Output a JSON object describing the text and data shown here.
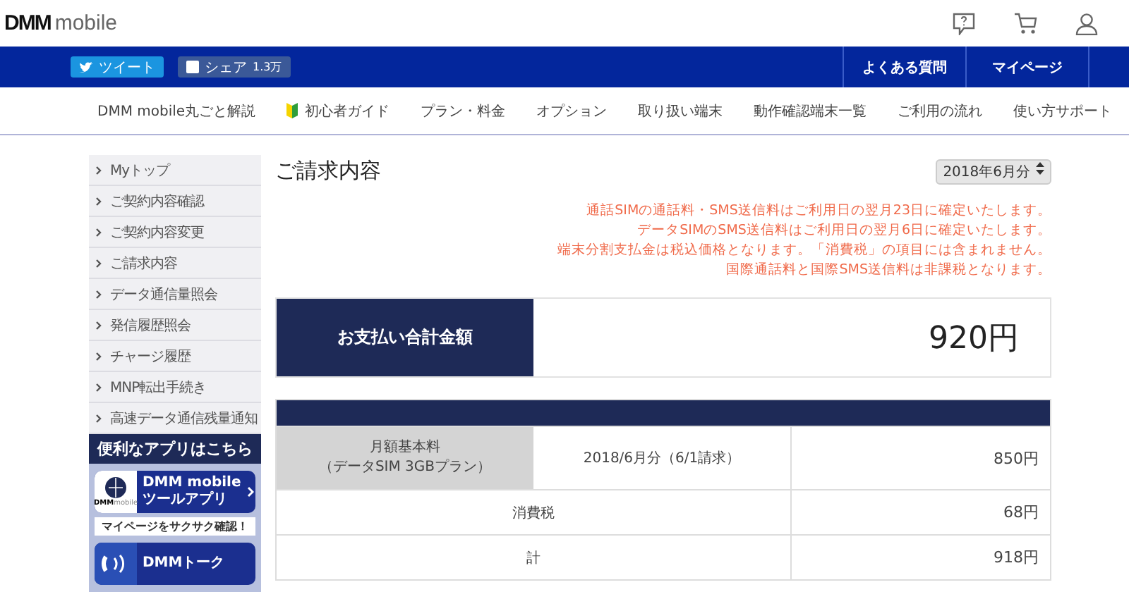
{
  "header": {
    "logo_bold": "DMM",
    "logo_light": "mobile"
  },
  "social": [
    {
      "kind": "twitter",
      "label": "ツイート"
    },
    {
      "kind": "facebook",
      "label": "シェア",
      "count": "1.3万"
    }
  ],
  "top_links": [
    "よくある質問",
    "マイページ"
  ],
  "nav": [
    {
      "label": "DMM mobile丸ごと解説",
      "kind": "plain"
    },
    {
      "label": "初心者ガイド",
      "kind": "beginner"
    },
    {
      "label": "プラン・料金",
      "kind": "plain"
    },
    {
      "label": "オプション",
      "kind": "plain"
    },
    {
      "label": "取り扱い端末",
      "kind": "plain"
    },
    {
      "label": "動作確認端末一覧",
      "kind": "plain"
    },
    {
      "label": "ご利用の流れ",
      "kind": "plain"
    },
    {
      "label": "使い方サポート",
      "kind": "plain"
    }
  ],
  "sidebar": {
    "items": [
      "Myトップ",
      "ご契約内容確認",
      "ご契約内容変更",
      "ご請求内容",
      "データ通信量照会",
      "発信履歴照会",
      "チャージ履歴",
      "MNP転出手続き",
      "高速データ通信残量通知"
    ],
    "promo_title": "便利なアプリはこちら",
    "apps": [
      {
        "title": "DMM mobile",
        "subtitle": "ツールアプリ",
        "logo_bold": "DMM",
        "logo_light": "mobile",
        "caption": "マイページをサクサク確認！"
      },
      {
        "title": "DMMトーク"
      }
    ]
  },
  "page_title": "ご請求内容",
  "month_select": {
    "value": "2018年6月分"
  },
  "notes": [
    "通話SIMの通話料・SMS送信料はご利用日の翌月23日に確定いたします。",
    "データSIMのSMS送信料はご利用日の翌月6日に確定いたします。",
    "端末分割支払金は税込価格となります。「消費税」の項目には含まれません。",
    "国際通話料と国際SMS送信料は非課税となります。"
  ],
  "total": {
    "label": "お支払い合計金額",
    "amount": "920円"
  },
  "table": {
    "rows": [
      {
        "kind": "item",
        "label_lines": [
          "月額基本料",
          "（データSIM 3GBプラン）"
        ],
        "period": "2018/6月分（6/1請求）",
        "amount": "850円"
      },
      {
        "kind": "sum",
        "label": "消費税",
        "amount": "68円"
      },
      {
        "kind": "sum",
        "label": "計",
        "amount": "918円"
      }
    ]
  }
}
